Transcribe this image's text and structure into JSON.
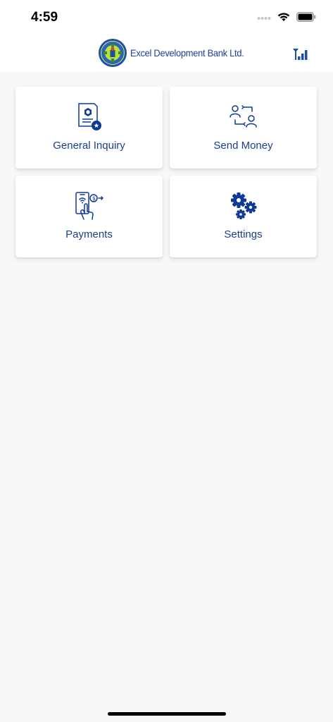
{
  "status_bar": {
    "time": "4:59"
  },
  "header": {
    "bank_name": "Excel Development Bank Ltd."
  },
  "menu": {
    "items": [
      {
        "label": "General Inquiry",
        "icon": "document-icon"
      },
      {
        "label": "Send Money",
        "icon": "transfer-users-icon"
      },
      {
        "label": "Payments",
        "icon": "mobile-payment-icon"
      },
      {
        "label": "Settings",
        "icon": "gears-icon"
      }
    ]
  },
  "colors": {
    "accent": "#1a3f8c",
    "icon_blue": "#0d3a99",
    "background": "#f8f8f8"
  }
}
